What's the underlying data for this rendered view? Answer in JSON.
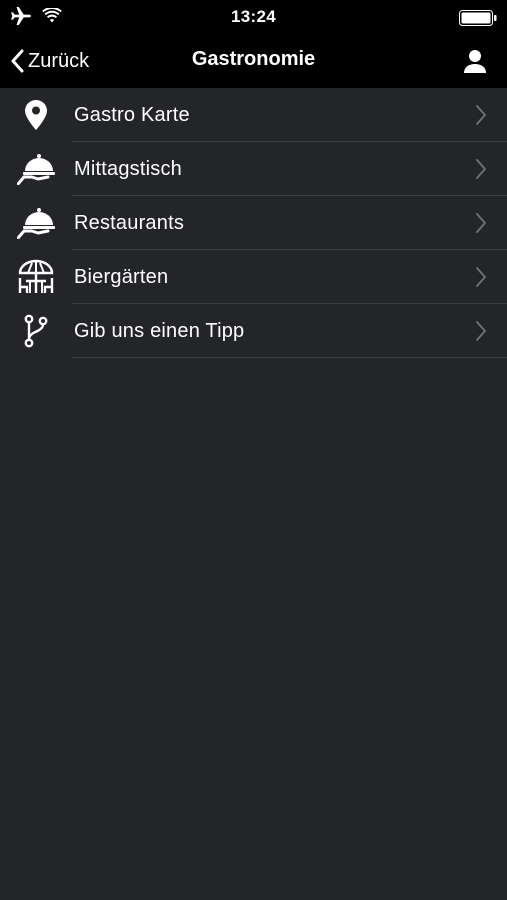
{
  "status_bar": {
    "time": "13:24",
    "icons": [
      "airplane-icon",
      "wifi-icon",
      "battery-icon"
    ]
  },
  "nav": {
    "back_label": "Zurück",
    "title": "Gastronomie",
    "profile_icon": "user-icon"
  },
  "menu": {
    "items": [
      {
        "label": "Gastro Karte",
        "icon": "map-pin-icon"
      },
      {
        "label": "Mittagstisch",
        "icon": "serving-cloche-icon"
      },
      {
        "label": "Restaurants",
        "icon": "serving-cloche-icon"
      },
      {
        "label": "Biergärten",
        "icon": "beer-garden-umbrella-icon"
      },
      {
        "label": "Gib uns einen Tipp",
        "icon": "branch-icon"
      }
    ]
  },
  "colors": {
    "background": "#242529",
    "bar": "#000000",
    "separator": "#3a3b40",
    "chevron": "#6e6f74"
  }
}
